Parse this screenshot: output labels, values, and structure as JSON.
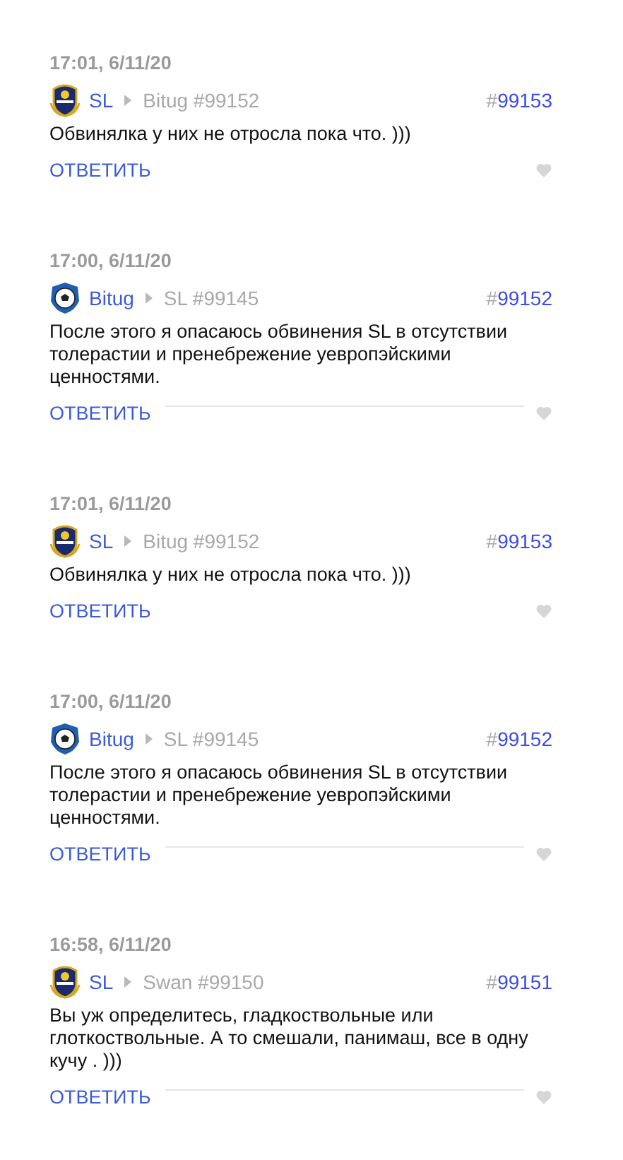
{
  "comments": [
    {
      "time": "17:01, 6/11/20",
      "kind": "shield",
      "author": "SL",
      "reply_to": "Bitug #99152",
      "hash": "#",
      "number": "99153",
      "text": "Обвинялка у них не отросла пока что. )))",
      "reply": "ОТВЕТИТЬ",
      "divider": false
    },
    {
      "time": "17:00, 6/11/20",
      "kind": "ball",
      "author": "Bitug",
      "reply_to": "SL #99145",
      "hash": "#",
      "number": "99152",
      "text": "После этого я опасаюсь обвинения SL в отсутствии толерастии и пренебрежение уевропэйскими ценностями.",
      "reply": "ОТВЕТИТЬ",
      "divider": true
    },
    {
      "time": "17:01, 6/11/20",
      "kind": "shield",
      "author": "SL",
      "reply_to": "Bitug #99152",
      "hash": "#",
      "number": "99153",
      "text": "Обвинялка у них не отросла пока что. )))",
      "reply": "ОТВЕТИТЬ",
      "divider": false
    },
    {
      "time": "17:00, 6/11/20",
      "kind": "ball",
      "author": "Bitug",
      "reply_to": "SL #99145",
      "hash": "#",
      "number": "99152",
      "text": "После этого я опасаюсь обвинения SL в отсутствии толерастии и пренебрежение уевропэйскими ценностями.",
      "reply": "ОТВЕТИТЬ",
      "divider": true
    },
    {
      "time": "16:58, 6/11/20",
      "kind": "shield",
      "author": "SL",
      "reply_to": "Swan #99150",
      "hash": "#",
      "number": "99151",
      "text": "Вы уж определитесь, гладкоствольные или глоткоствольные. А то смешали, панимаш, все в одну кучу . )))",
      "reply": "ОТВЕТИТЬ",
      "divider": true
    }
  ]
}
